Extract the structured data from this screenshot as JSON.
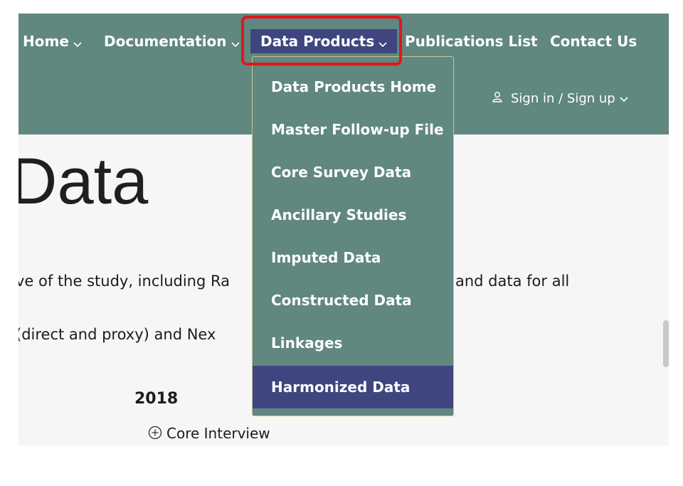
{
  "nav": {
    "home": "Home",
    "documentation": "Documentation",
    "data_products": "Data Products",
    "publications": "Publications List",
    "contact": "Contact Us"
  },
  "account": {
    "signin_label": "Sign in / Sign up",
    "icon": "user-icon"
  },
  "dropdown": {
    "items": [
      "Data Products Home",
      "Master Follow-up File",
      "Core Survey Data",
      "Ancillary Studies",
      "Imputed Data",
      "Constructed Data",
      "Linkages",
      "Harmonized Data"
    ],
    "active_index": 7
  },
  "page": {
    "title": "Data",
    "line1_left": "ve of the study, including Ra",
    "line1_right": "and data for all",
    "line2": "(direct and proxy) and Nex",
    "year": "2018",
    "core_interview": "Core Interview"
  },
  "colors": {
    "header_bg": "#608780",
    "active_bg": "#3f457f",
    "highlight_border": "#e3151b"
  }
}
